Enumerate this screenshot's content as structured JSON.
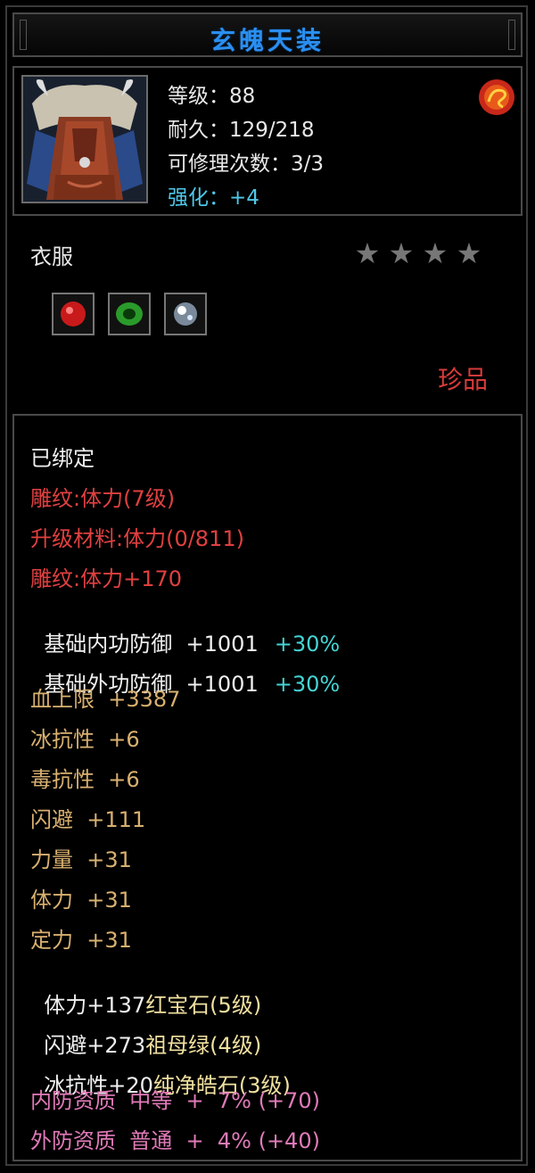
{
  "title": "玄魄天装",
  "attributes": {
    "level": "等级：88",
    "durability": "耐久：129/218",
    "repair_count": "可修理次数：3/3",
    "enhance": "强化：+4"
  },
  "slot": "衣服",
  "stars": [
    "★",
    "★",
    "★",
    "★"
  ],
  "rarity": "珍品",
  "gems": [
    "ruby-gem-icon",
    "emerald-gem-icon",
    "diamond-gem-icon"
  ],
  "stats": {
    "bound": "已绑定",
    "engrave1": "雕纹:体力(7级)",
    "upgrade": "升级材料:体力(0/811)",
    "engrave2": "雕纹:体力+170",
    "inner_def_label": "基础内功防御  +1001",
    "inner_def_pct": "+30%",
    "outer_def_label": "基础外功防御  +1001",
    "outer_def_pct": "+30%",
    "hp": "血上限  +3387",
    "ice_res": "冰抗性  +6",
    "poison_res": "毒抗性  +6",
    "dodge": "闪避  +111",
    "strength": "力量  +31",
    "stamina": "体力  +31",
    "focus": "定力  +31",
    "gem1_prefix": "体力+137",
    "gem1_name": "红宝石(5级)",
    "gem2_prefix": "闪避+273",
    "gem2_name": "祖母绿(4级)",
    "gem3_prefix": "冰抗性+20",
    "gem3_name": "纯净皓石(3级)",
    "inner_quality": "内防资质  中等  +  7% (+70)",
    "outer_quality": "外防资质  普通  +  4% (+40)"
  },
  "colors": {
    "title": "#2a8ff0",
    "red": "#e04040",
    "gold": "#d8b070",
    "cyan": "#46d4d4",
    "pink": "#e07ab8"
  }
}
